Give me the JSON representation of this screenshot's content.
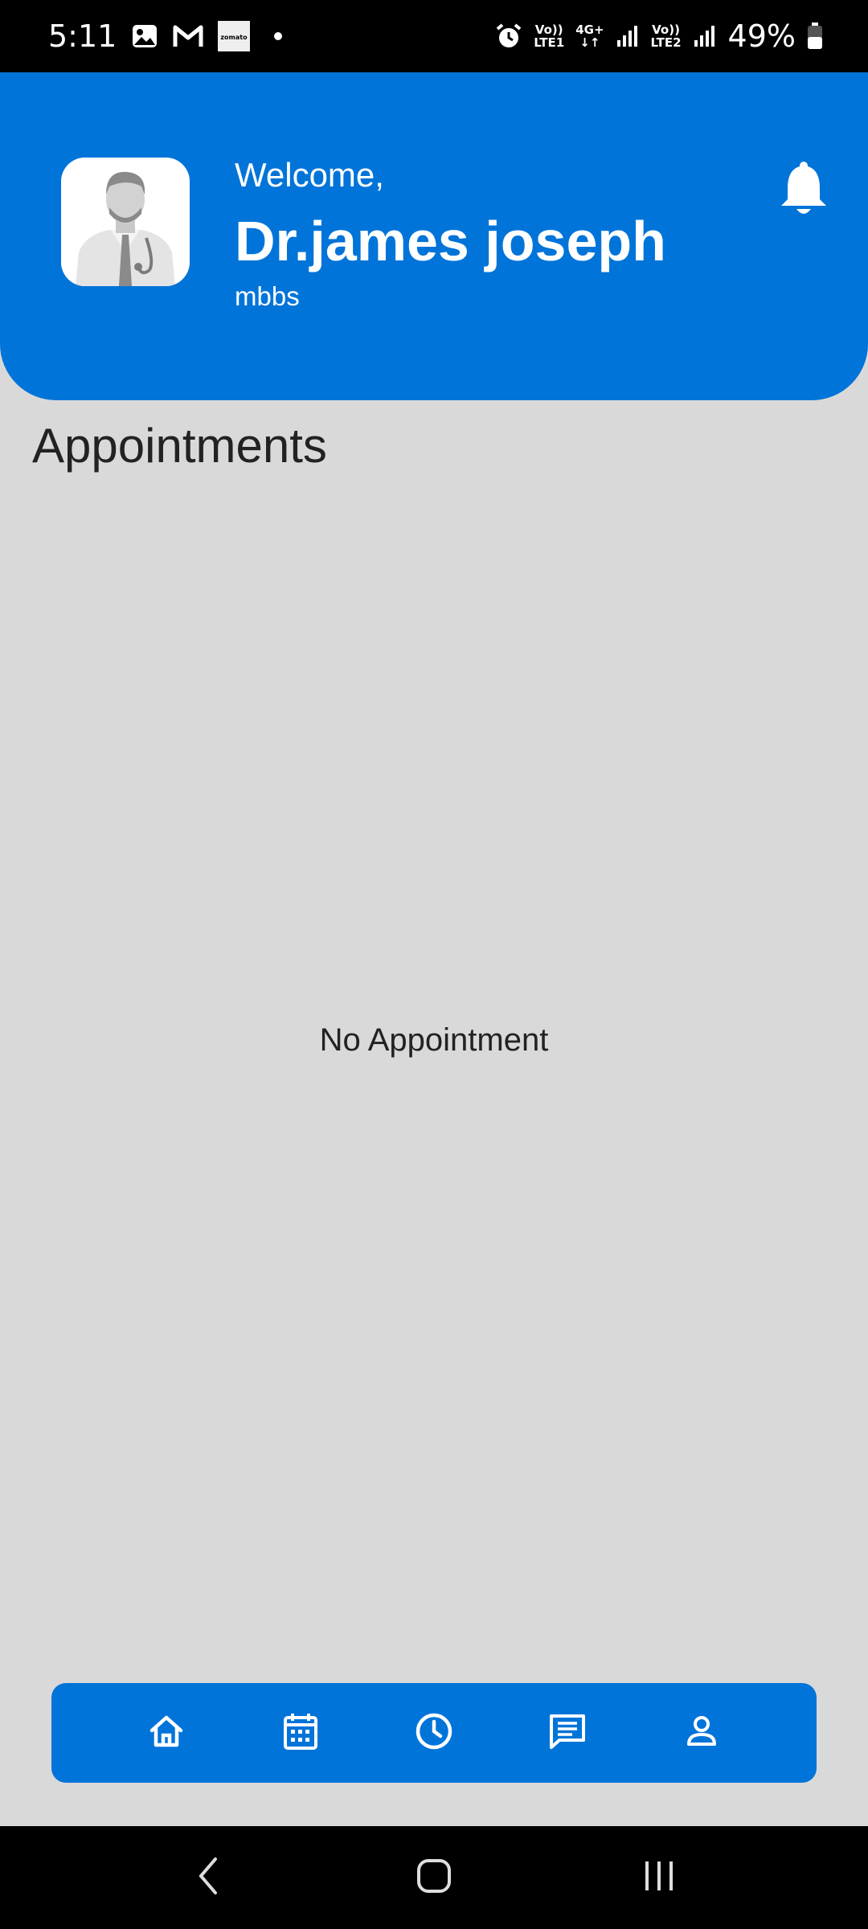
{
  "status_bar": {
    "time": "5:11",
    "sim1_top": "Vo))",
    "sim1_bottom": "LTE1",
    "data_top": "4G+",
    "data_bottom": "↓↑",
    "sim2_top": "Vo))",
    "sim2_bottom": "LTE2",
    "battery": "49%",
    "icons": [
      "gallery-icon",
      "gmail-icon",
      "zomato-icon",
      "alarm-icon",
      "signal-icon",
      "battery-icon"
    ],
    "zomato_label": "zomato"
  },
  "header": {
    "welcome": "Welcome,",
    "name": "Dr.james joseph",
    "degree": "mbbs",
    "accent": "#0074d9"
  },
  "main": {
    "section_title": "Appointments",
    "empty_message": "No Appointment"
  },
  "bottom_nav": {
    "items": [
      "home-icon",
      "calendar-icon",
      "clock-icon",
      "chat-icon",
      "profile-icon"
    ]
  },
  "system_nav": {
    "items": [
      "back-icon",
      "home-button-icon",
      "recents-icon"
    ]
  }
}
